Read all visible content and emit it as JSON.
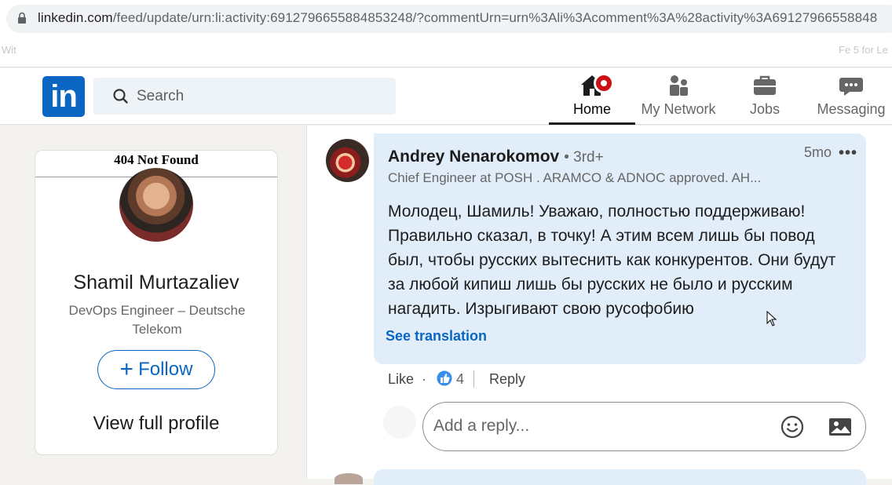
{
  "browser": {
    "url_host": "linkedin.com",
    "url_path": "/feed/update/urn:li:activity:6912796655884853248/?commentUrn=urn%3Ali%3Acomment%3A%28activity%3A69127966558848",
    "bookmark_left": "Wit",
    "bookmark_right": "Fe 5 for Le"
  },
  "nav": {
    "search_placeholder": "Search",
    "items": [
      {
        "label": "Home",
        "icon": "home-icon",
        "active": true
      },
      {
        "label": "My Network",
        "icon": "network-icon"
      },
      {
        "label": "Jobs",
        "icon": "briefcase-icon"
      },
      {
        "label": "Messaging",
        "icon": "chat-icon"
      }
    ]
  },
  "profile_card": {
    "banner_text": "404 Not Found",
    "name": "Shamil Murtazaliev",
    "title": "DevOps Engineer – Deutsche Telekom",
    "follow_label": "Follow",
    "view_profile_label": "View full profile"
  },
  "comment": {
    "author": "Andrey Nenarokomov",
    "degree": "• 3rd+",
    "time": "5mo",
    "more": "•••",
    "headline": "Chief Engineer at POSH . ARAMCO & ADNOC approved. AH...",
    "body": "Молодец, Шамиль! Уважаю, полностью поддерживаю! Правильно сказал, в точку! А этим всем лишь бы повод был, чтобы русских вытеснить как конкурентов. Они будут за любой кипиш лишь бы русских не было и русским нагадить. Изрыгивают свою русофобию",
    "translate_label": "See translation",
    "like_label": "Like",
    "dot": "·",
    "reaction_count": "4",
    "reply_label": "Reply"
  },
  "reply": {
    "placeholder": "Add a reply..."
  },
  "colors": {
    "brand": "#0a66c2",
    "comment_bg": "#e1edf9",
    "badge": "#cc1016"
  }
}
